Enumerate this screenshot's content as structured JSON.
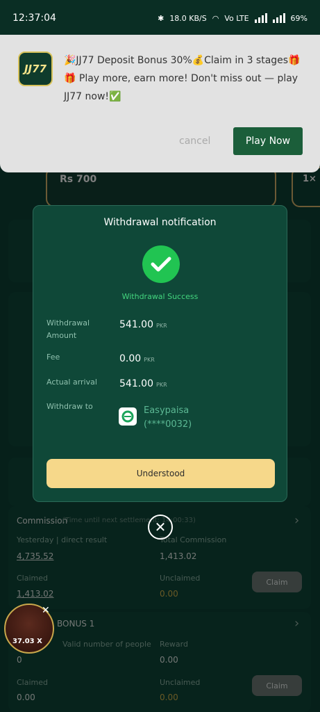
{
  "status_bar": {
    "time": "12:37:04",
    "speed": "18.0 KB/S",
    "network": "Vo LTE",
    "battery": "69%"
  },
  "notification": {
    "app_logo": "JJ77",
    "message": "🎉JJ77 Deposit Bonus 30%💰Claim in 3 stages🎁🎁 Play more, earn more! Don't miss out — play JJ77 now!✅",
    "cancel_label": "cancel",
    "play_label": "Play Now"
  },
  "background": {
    "banner_amount": "Rs 700",
    "banner2_text": "1×",
    "commission_title": "Commission",
    "commission_sub": "(Time until next settlement: 14:00:33)",
    "yesterday_label": "Yesterday | direct result",
    "yesterday_value": "4,735.52",
    "total_commission_label": "Total Commission",
    "total_commission_value": "1,413.02",
    "claimed_label": "Claimed",
    "claimed_value": "1,413.02",
    "unclaimed_label": "Unclaimed",
    "unclaimed_value": "0.00",
    "claim_label": "Claim",
    "bonus_title": "BONUS 1",
    "people_label": "Valid number of people",
    "people_value": "0",
    "reward_label": "Reward",
    "reward_value": "0.00",
    "claimed2_value": "0.00",
    "unclaimed2_value": "0.00",
    "float_badge": "37.03 X"
  },
  "modal": {
    "title": "Withdrawal notification",
    "success": "Withdrawal Success",
    "amount_label": "Withdrawal Amount",
    "amount_value": "541.00",
    "fee_label": "Fee",
    "fee_value": "0.00",
    "arrival_label": "Actual arrival",
    "arrival_value": "541.00",
    "currency": "PKR",
    "to_label": "Withdraw to",
    "wallet_name": "Easypaisa",
    "wallet_account": "(****0032)",
    "button": "Understood"
  },
  "colors": {
    "accent": "#21c452",
    "button": "#f6d88a",
    "bg": "#0c3a2e"
  }
}
